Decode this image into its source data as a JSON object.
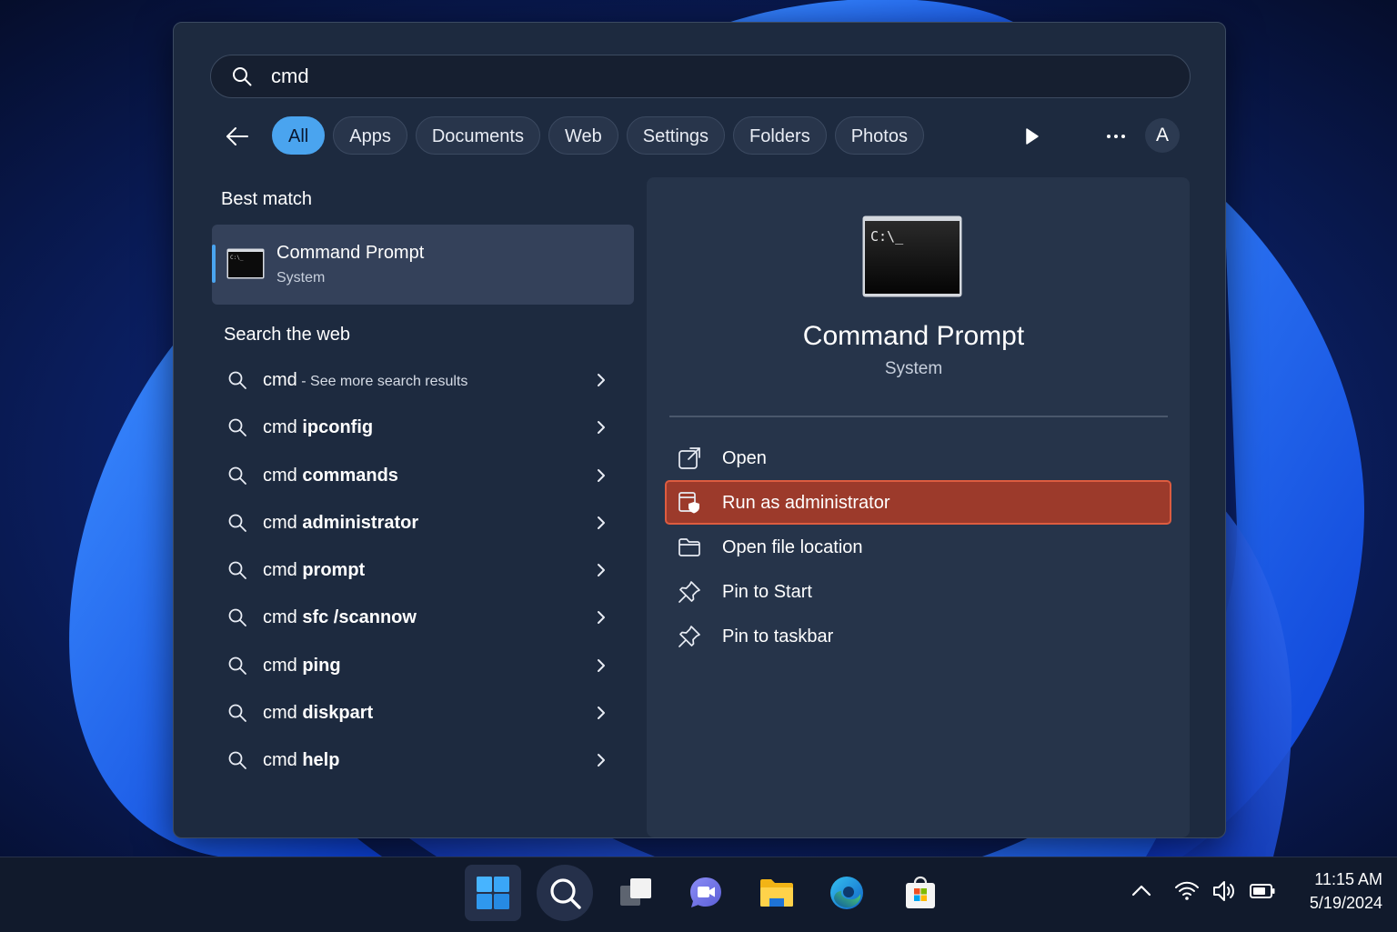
{
  "search": {
    "query": "cmd"
  },
  "filters": {
    "tabs": [
      {
        "label": "All",
        "active": true
      },
      {
        "label": "Apps"
      },
      {
        "label": "Documents"
      },
      {
        "label": "Web"
      },
      {
        "label": "Settings"
      },
      {
        "label": "Folders"
      },
      {
        "label": "Photos"
      }
    ],
    "avatar_initial": "A"
  },
  "best_match": {
    "heading": "Best match",
    "name": "Command Prompt",
    "type": "System",
    "icon_text": "C:\\_"
  },
  "search_web": {
    "heading": "Search the web",
    "items": [
      {
        "prefix": "cmd",
        "term": "",
        "suffix": " - See more search results"
      },
      {
        "prefix": "cmd ",
        "term": "ipconfig"
      },
      {
        "prefix": "cmd ",
        "term": "commands"
      },
      {
        "prefix": "cmd ",
        "term": "administrator"
      },
      {
        "prefix": "cmd ",
        "term": "prompt"
      },
      {
        "prefix": "cmd ",
        "term": "sfc /scannow"
      },
      {
        "prefix": "cmd ",
        "term": "ping"
      },
      {
        "prefix": "cmd ",
        "term": "diskpart"
      },
      {
        "prefix": "cmd ",
        "term": "help"
      }
    ]
  },
  "detail": {
    "title": "Command Prompt",
    "subtitle": "System",
    "icon_text": "C:\\_",
    "actions": [
      {
        "label": "Open",
        "icon": "open-external-icon"
      },
      {
        "label": "Run as administrator",
        "icon": "shield-admin-icon",
        "highlighted": true
      },
      {
        "label": "Open file location",
        "icon": "folder-icon"
      },
      {
        "label": "Pin to Start",
        "icon": "pin-icon"
      },
      {
        "label": "Pin to taskbar",
        "icon": "pin-icon"
      }
    ]
  },
  "taskbar": {
    "apps": [
      "start-icon",
      "search-icon",
      "task-view-icon",
      "teams-chat-icon",
      "file-explorer-icon",
      "edge-icon",
      "store-icon"
    ],
    "tray": [
      "chevron-up-icon",
      "wifi-icon",
      "volume-icon",
      "battery-icon"
    ],
    "time": "11:15 AM",
    "date": "5/19/2024"
  },
  "colors": {
    "accent": "#4aa4ef",
    "highlight": "#9c3a2b",
    "highlight_border": "#dd5c40",
    "panel": "#1d2a3f"
  }
}
